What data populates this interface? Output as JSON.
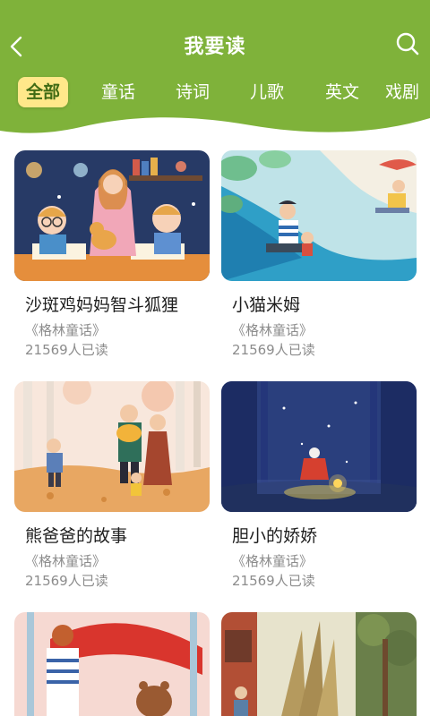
{
  "header": {
    "title": "我要读",
    "back_icon": "chevron-left-icon",
    "search_icon": "search-icon",
    "background_color": "#7fb23a"
  },
  "tabs": [
    {
      "label": "全部",
      "active": true
    },
    {
      "label": "童话",
      "active": false
    },
    {
      "label": "诗词",
      "active": false
    },
    {
      "label": "儿歌",
      "active": false
    },
    {
      "label": "英文",
      "active": false
    },
    {
      "label": "戏剧",
      "active": false
    }
  ],
  "books": [
    {
      "title": "沙斑鸡妈妈智斗狐狸",
      "series": "《格林童话》",
      "reads": "21569人已读"
    },
    {
      "title": "小猫米姆",
      "series": "《格林童话》",
      "reads": "21569人已读"
    },
    {
      "title": "熊爸爸的故事",
      "series": "《格林童话》",
      "reads": "21569人已读"
    },
    {
      "title": "胆小的娇娇",
      "series": "《格林童话》",
      "reads": "21569人已读"
    },
    {
      "title": "",
      "series": "",
      "reads": ""
    },
    {
      "title": "",
      "series": "",
      "reads": ""
    }
  ]
}
